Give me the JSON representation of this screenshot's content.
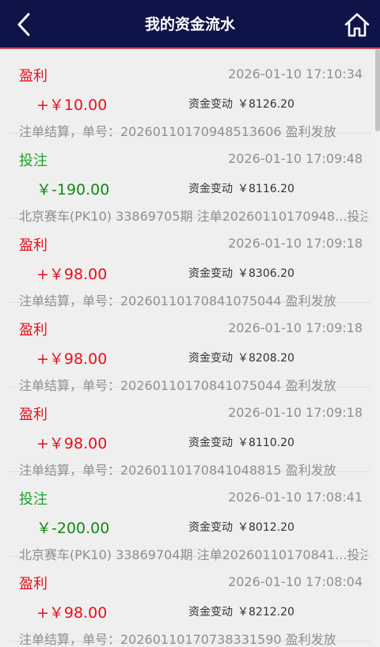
{
  "header": {
    "title": "我的资金流水",
    "back_icon": "back-arrow-icon",
    "home_icon": "home-icon"
  },
  "colors": {
    "header_bg": "#0e1447",
    "win": "#e8101c",
    "bet": "#1aa32a",
    "muted": "#8f8f8f"
  },
  "records": [
    {
      "type": "盈利",
      "kind": "win",
      "time": "2026-01-10 17:10:34",
      "amount": "+￥10.00",
      "change_label": "资金变动",
      "change_value": "￥8126.20",
      "note": "注单结算，单号：20260110170948513606 盈利发放"
    },
    {
      "type": "投注",
      "kind": "bet",
      "time": "2026-01-10 17:09:48",
      "amount": "￥-190.00",
      "change_label": "资金变动",
      "change_value": "￥8116.20",
      "note": "北京赛车(PK10) 33869705期 注单20260110170948...投注"
    },
    {
      "type": "盈利",
      "kind": "win",
      "time": "2026-01-10 17:09:18",
      "amount": "+￥98.00",
      "change_label": "资金变动",
      "change_value": "￥8306.20",
      "note": "注单结算，单号：20260110170841075044 盈利发放"
    },
    {
      "type": "盈利",
      "kind": "win",
      "time": "2026-01-10 17:09:18",
      "amount": "+￥98.00",
      "change_label": "资金变动",
      "change_value": "￥8208.20",
      "note": "注单结算，单号：20260110170841075044 盈利发放"
    },
    {
      "type": "盈利",
      "kind": "win",
      "time": "2026-01-10 17:09:18",
      "amount": "+￥98.00",
      "change_label": "资金变动",
      "change_value": "￥8110.20",
      "note": "注单结算，单号：20260110170841048815 盈利发放"
    },
    {
      "type": "投注",
      "kind": "bet",
      "time": "2026-01-10 17:08:41",
      "amount": "￥-200.00",
      "change_label": "资金变动",
      "change_value": "￥8012.20",
      "note": "北京赛车(PK10) 33869704期 注单20260110170841...投注"
    },
    {
      "type": "盈利",
      "kind": "win",
      "time": "2026-01-10 17:08:04",
      "amount": "+￥98.00",
      "change_label": "资金变动",
      "change_value": "￥8212.20",
      "note": "注单结算，单号：20260110170738331590 盈利发放"
    }
  ]
}
